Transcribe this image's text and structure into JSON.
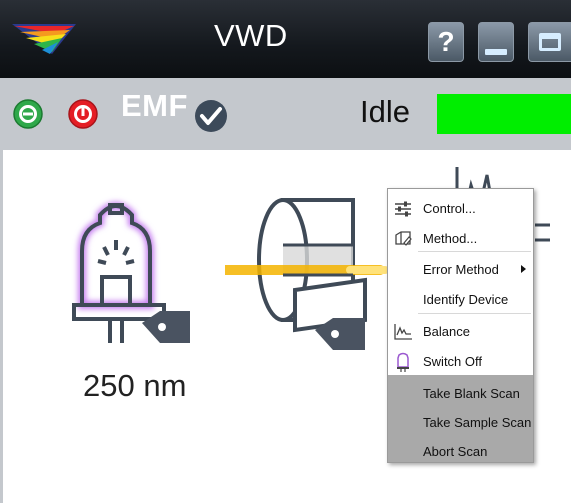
{
  "window": {
    "title": "VWD",
    "help_label": "?",
    "colors": {
      "titlebar": "#14181d",
      "status_bar": "#c4c8cd",
      "led": "#00ee00"
    }
  },
  "status": {
    "emf_label": "EMF",
    "state": "Idle",
    "on_icon": "green-power-on-icon",
    "off_icon": "red-power-off-icon"
  },
  "device": {
    "wavelength": "250 nm",
    "lamp_icon": "uv-lamp-icon",
    "cell_icon": "flow-cell-icon"
  },
  "context_menu": {
    "items": [
      {
        "label": "Control...",
        "icon": "sliders-icon"
      },
      {
        "label": "Method...",
        "icon": "method-icon"
      },
      {
        "label": "Error Method",
        "submenu": true
      },
      {
        "label": "Identify Device"
      },
      {
        "label": "Balance",
        "icon": "balance-signal-icon"
      },
      {
        "label": "Switch Off",
        "icon": "lamp-off-icon"
      },
      {
        "label": "Take Blank Scan",
        "disabled": true
      },
      {
        "label": "Take Sample Scan",
        "disabled": true
      },
      {
        "label": "Abort Scan",
        "disabled": true
      }
    ]
  }
}
